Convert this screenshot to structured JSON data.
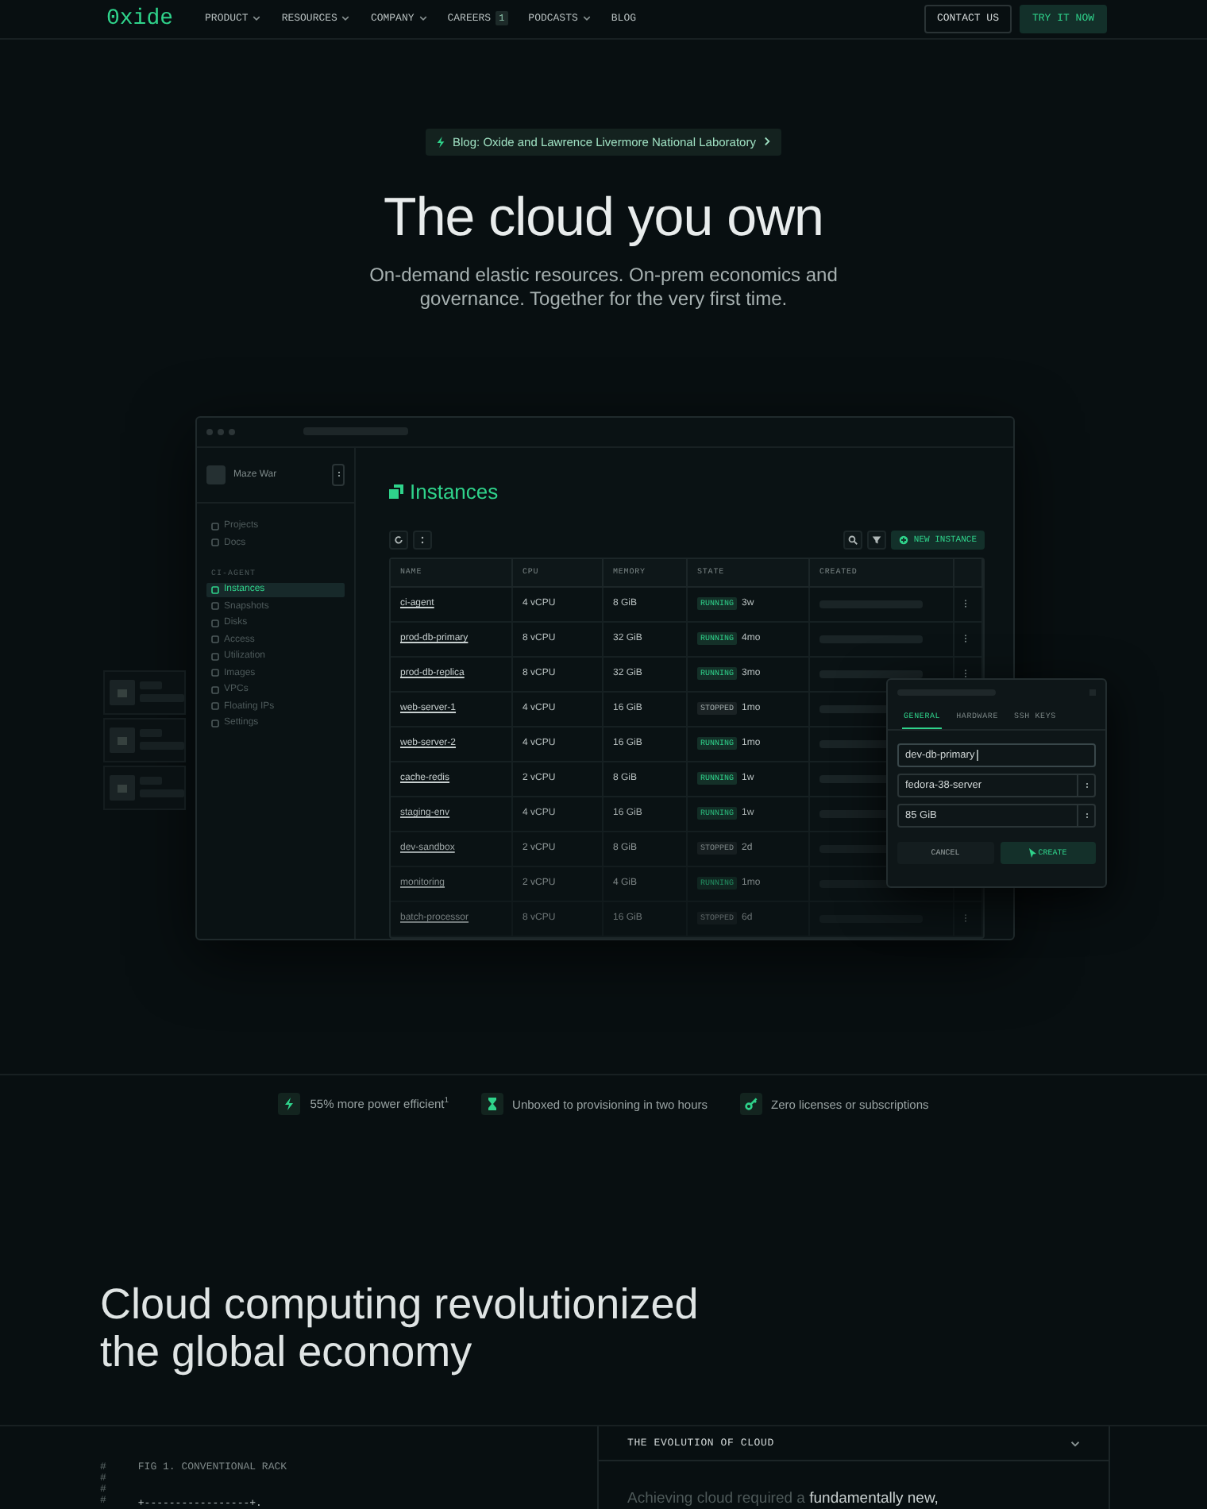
{
  "nav": {
    "logo": "0xide",
    "items": [
      {
        "label": "PRODUCT",
        "dropdown": true
      },
      {
        "label": "RESOURCES",
        "dropdown": true
      },
      {
        "label": "COMPANY",
        "dropdown": true
      },
      {
        "label": "CAREERS",
        "badge": "1",
        "dropdown": false
      },
      {
        "label": "PODCASTS",
        "dropdown": true
      },
      {
        "label": "BLOG",
        "dropdown": false
      }
    ],
    "buttons": [
      {
        "label": "CONTACT US",
        "kind": "outline"
      },
      {
        "label": "TRY IT NOW",
        "kind": "primary"
      }
    ]
  },
  "hero": {
    "announcement": "Blog: Oxide and Lawrence Livermore National Laboratory",
    "title": "The cloud you own",
    "subtitle": "On-demand elastic resources. On-prem economics and governance. Together for the very first time."
  },
  "console": {
    "project": "Maze War",
    "links": [
      "Projects",
      "Docs"
    ],
    "section": "CI-AGENT",
    "menu": [
      {
        "label": "Instances",
        "selected": true
      },
      {
        "label": "Snapshots",
        "selected": false
      },
      {
        "label": "Disks",
        "selected": false
      },
      {
        "label": "Access",
        "selected": false
      },
      {
        "label": "Utilization",
        "selected": false
      },
      {
        "label": "Images",
        "selected": false
      },
      {
        "label": "VPCs",
        "selected": false
      },
      {
        "label": "Floating IPs",
        "selected": false
      },
      {
        "label": "Settings",
        "selected": false
      }
    ],
    "page_title": "Instances",
    "new_button": "NEW INSTANCE",
    "table": {
      "columns": [
        "NAME",
        "CPU",
        "MEMORY",
        "STATE",
        "CREATED"
      ],
      "rows": [
        {
          "name": "ci-agent",
          "cpu": "4 vCPU",
          "memory": "8 GiB",
          "state": "RUNNING",
          "kind": "running",
          "age": "3w"
        },
        {
          "name": "prod-db-primary",
          "cpu": "8 vCPU",
          "memory": "32 GiB",
          "state": "RUNNING",
          "kind": "running",
          "age": "4mo"
        },
        {
          "name": "prod-db-replica",
          "cpu": "8 vCPU",
          "memory": "32 GiB",
          "state": "RUNNING",
          "kind": "running",
          "age": "3mo"
        },
        {
          "name": "web-server-1",
          "cpu": "4 vCPU",
          "memory": "16 GiB",
          "state": "STOPPED",
          "kind": "stopped",
          "age": "1mo"
        },
        {
          "name": "web-server-2",
          "cpu": "4 vCPU",
          "memory": "16 GiB",
          "state": "RUNNING",
          "kind": "running",
          "age": "1mo"
        },
        {
          "name": "cache-redis",
          "cpu": "2 vCPU",
          "memory": "8 GiB",
          "state": "RUNNING",
          "kind": "running",
          "age": "1w"
        },
        {
          "name": "staging-env",
          "cpu": "4 vCPU",
          "memory": "16 GiB",
          "state": "RUNNING",
          "kind": "running",
          "age": "1w"
        },
        {
          "name": "dev-sandbox",
          "cpu": "2 vCPU",
          "memory": "8 GiB",
          "state": "STOPPED",
          "kind": "stopped",
          "age": "2d"
        },
        {
          "name": "monitoring",
          "cpu": "2 vCPU",
          "memory": "4 GiB",
          "state": "RUNNING",
          "kind": "running",
          "age": "1mo"
        },
        {
          "name": "batch-processor",
          "cpu": "8 vCPU",
          "memory": "16 GiB",
          "state": "STOPPED",
          "kind": "stopped",
          "age": "6d"
        }
      ]
    },
    "dialog": {
      "tabs": [
        {
          "label": "GENERAL",
          "selected": true
        },
        {
          "label": "HARDWARE",
          "selected": false
        },
        {
          "label": "SSH KEYS",
          "selected": false
        }
      ],
      "name_value": "dev-db-primary",
      "image_value": "fedora-38-server",
      "disk_value": "85 GiB",
      "buttons": [
        {
          "label": "CANCEL",
          "kind": "secondary"
        },
        {
          "label": "CREATE",
          "kind": "primary"
        }
      ]
    }
  },
  "features": [
    {
      "kind": "bolt",
      "text": "55% more power efficient$^{1}$"
    },
    {
      "kind": "hourglass",
      "text": "Unboxed to provisioning in two hours"
    },
    {
      "kind": "key",
      "text": "Zero licenses or subscriptions"
    }
  ],
  "section": {
    "heading": "Cloud computing revolutionized the global economy",
    "figure": {
      "marks": [
        "#",
        "#",
        "#",
        "#"
      ],
      "caption": "FIG 1. CONVENTIONAL RACK",
      "art": "+-----------------+."
    },
    "accordion": {
      "title": "THE EVOLUTION OF CLOUD",
      "expanded": true,
      "body": "Achieving cloud required a **fundamentally new,**"
    }
  }
}
